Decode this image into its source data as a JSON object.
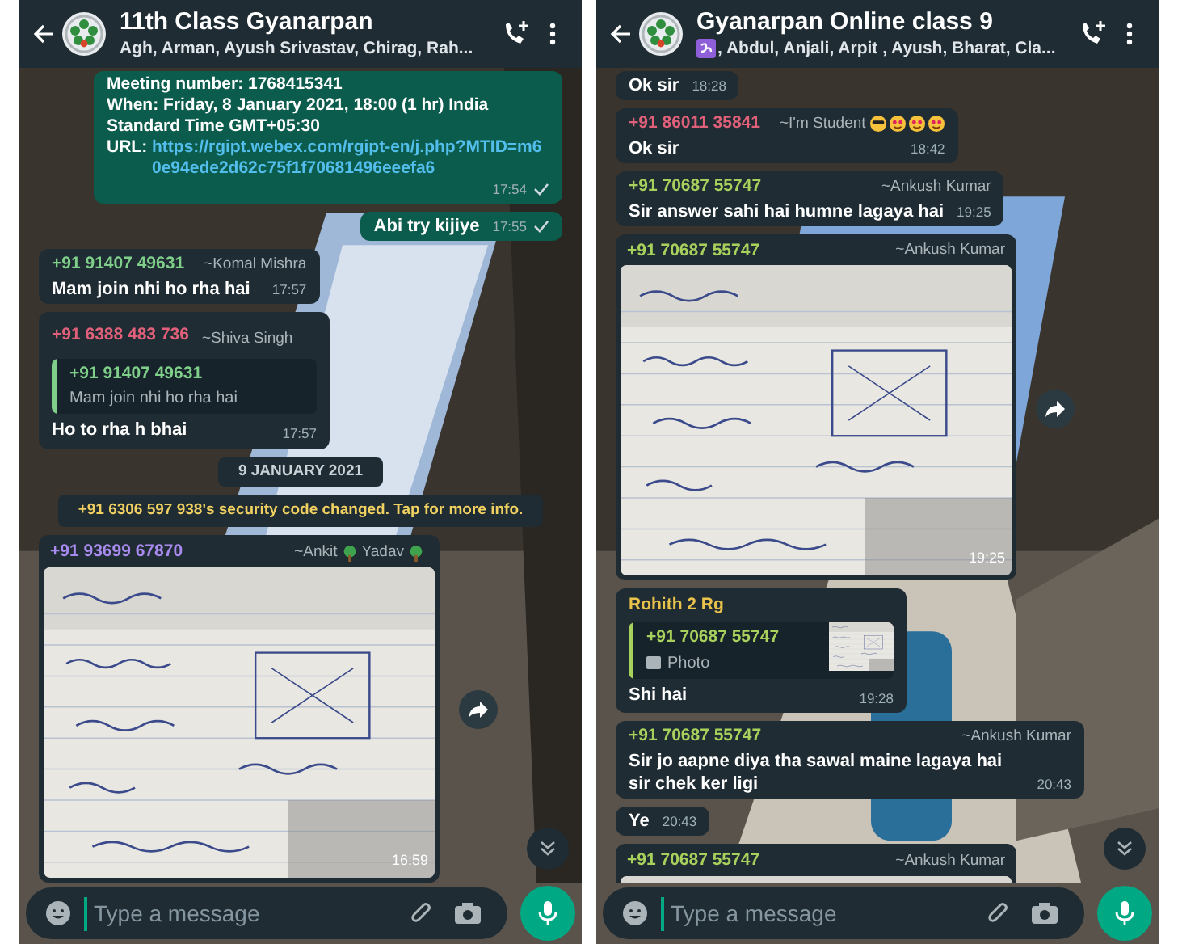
{
  "phones": [
    {
      "header": {
        "title": "11th Class Gyanarpan",
        "subtitle": [
          {
            "kind": "text",
            "text": "Agh, Arman, Ayush Srivastav, Chirag, Rah..."
          }
        ]
      },
      "messages": [
        {
          "kind": "link",
          "outgoing": true,
          "lines": [
            "Meeting number: 1768415341",
            "When: Friday, 8 January 2021, 18:00 (1 hr) India Standard Time GMT+05:30"
          ],
          "label": "URL: ",
          "link": "https://rgipt.webex.com/rgipt-en/j.php?MTID=m60e94ede2d62c75f1f70681496eeefa6",
          "time": "17:54",
          "sent": true
        },
        {
          "kind": "text",
          "outgoing": true,
          "text": "Abi try kijiye",
          "time": "17:55",
          "sent": true
        },
        {
          "kind": "text",
          "outgoing": false,
          "sender": "+91 91407 49631",
          "color": "#7fcf8a",
          "name": [
            {
              "kind": "text",
              "text": "~Komal Mishra"
            }
          ],
          "text": "Mam join nhi ho rha hai",
          "time": "17:57"
        },
        {
          "kind": "quote",
          "outgoing": false,
          "sender": "+91 6388 483 736",
          "color": "#e0607a",
          "name": [
            {
              "kind": "text",
              "text": "~Shiva Singh"
            }
          ],
          "quote": {
            "sender": "+91 91407 49631",
            "color": "#7fcf8a",
            "text": "Mam join nhi ho rha hai"
          },
          "text": "Ho to rha h bhai",
          "time": "17:57"
        },
        {
          "kind": "date",
          "text": "9 JANUARY 2021"
        },
        {
          "kind": "system",
          "text": "+91 6306 597 938's security code changed. Tap for more info."
        },
        {
          "outgoing": false,
          "sender": "+91 93699 67870",
          "color": "#a98bf0",
          "name": [
            {
              "kind": "text",
              "text": "~Ankit"
            },
            {
              "kind": "tree"
            },
            {
              "kind": "text",
              "text": "Yadav"
            },
            {
              "kind": "tree"
            }
          ],
          "time": "16:59",
          "forward": true
        }
      ],
      "composer": {
        "placeholder": "Type a message"
      }
    },
    {
      "header": {
        "title": "Gyanarpan Online class 9",
        "subtitle": [
          {
            "kind": "om"
          },
          {
            "kind": "text",
            "text": ", Abdul, Anjali, Arpit , Ayush, Bharat, Cla..."
          }
        ]
      },
      "messages": [
        {
          "kind": "text",
          "outgoing": false,
          "text": "Ok sir",
          "time": "18:28"
        },
        {
          "kind": "text",
          "outgoing": false,
          "sender": "+91 86011 35841",
          "color": "#e0607a",
          "name": [
            {
              "kind": "text",
              "text": "~I'm Student"
            },
            {
              "kind": "cool"
            },
            {
              "kind": "love"
            },
            {
              "kind": "love"
            },
            {
              "kind": "love"
            }
          ],
          "text": "Ok sir",
          "time": "18:42"
        },
        {
          "kind": "text",
          "outgoing": false,
          "sender": "+91 70687 55747",
          "color": "#a8d05c",
          "name": [
            {
              "kind": "text",
              "text": "~Ankush Kumar"
            }
          ],
          "text": "Sir answer sahi hai humne lagaya hai",
          "time": "19:25"
        },
        {
          "outgoing": false,
          "sender": "+91 70687 55747",
          "color": "#a8d05c",
          "name": [
            {
              "kind": "text",
              "text": "~Ankush Kumar"
            }
          ],
          "time": "19:25",
          "forward": true
        },
        {
          "kind": "photo_reply",
          "outgoing": false,
          "sender": "Rohith 2 Rg",
          "color": "#e8c24a",
          "quote": {
            "sender": "+91 70687 55747",
            "color": "#a8d05c",
            "text": "Photo"
          },
          "text": "Shi hai",
          "time": "19:28"
        },
        {
          "kind": "text",
          "outgoing": false,
          "sender": "+91 70687 55747",
          "color": "#a8d05c",
          "name": [
            {
              "kind": "text",
              "text": "~Ankush Kumar"
            }
          ],
          "text": "Sir jo aapne diya tha sawal maine lagaya hai sir chek ker ligi",
          "time": "20:43"
        },
        {
          "kind": "text",
          "outgoing": false,
          "text": "Ye",
          "time": "20:43"
        },
        {
          "outgoing": false,
          "sender": "+91 70687 55747",
          "color": "#a8d05c",
          "name": [
            {
              "kind": "text",
              "text": "~Ankush Kumar"
            }
          ]
        }
      ],
      "composer": {
        "placeholder": "Type a message"
      }
    }
  ]
}
